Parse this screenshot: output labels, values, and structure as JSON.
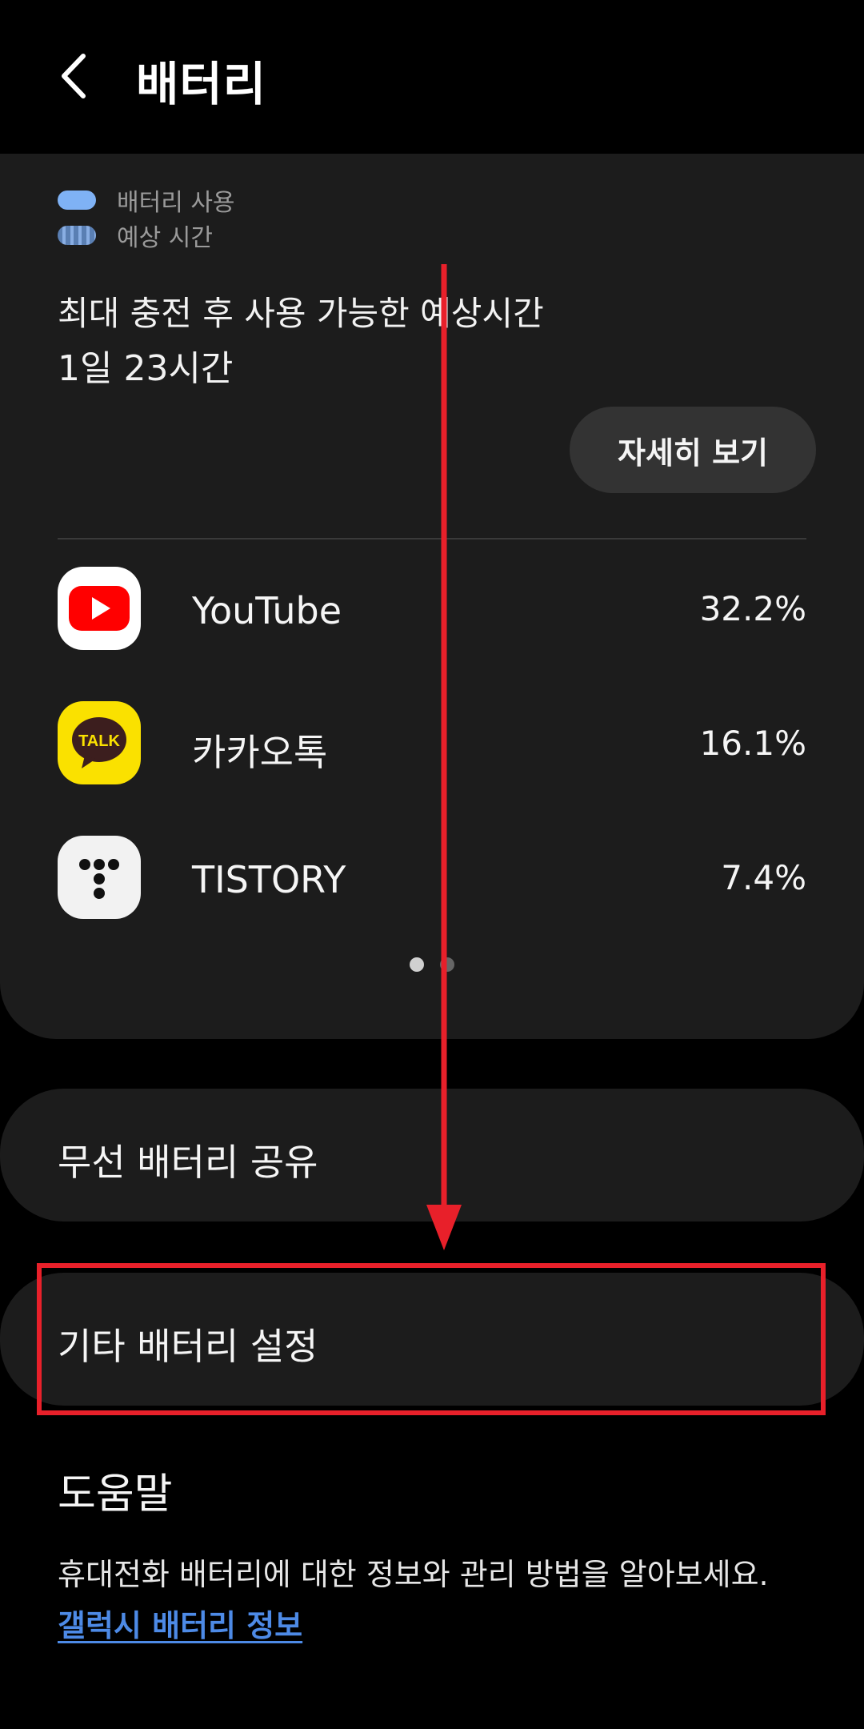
{
  "header": {
    "title": "배터리",
    "back_icon": "chevron-left-icon"
  },
  "legend": [
    {
      "label": "배터리 사용",
      "color": "#7fb2f5"
    },
    {
      "label": "예상 시간",
      "color": "#6a92cc"
    }
  ],
  "estimate": {
    "label": "최대 충전 후 사용 가능한 예상시간",
    "value": "1일 23시간"
  },
  "details_button": "자세히 보기",
  "apps": [
    {
      "name": "YouTube",
      "percent": "32.2%",
      "icon": "youtube-icon"
    },
    {
      "name": "카카오톡",
      "percent": "16.1%",
      "icon": "kakaotalk-icon",
      "icon_text": "TALK"
    },
    {
      "name": "TISTORY",
      "percent": "7.4%",
      "icon": "tistory-icon"
    }
  ],
  "pager": {
    "pages": 2,
    "current": 1
  },
  "settings": {
    "wireless_share": "무선 배터리 공유",
    "other_settings": "기타 배터리 설정"
  },
  "help": {
    "title": "도움말",
    "description": "휴대전화 배터리에 대한 정보와 관리 방법을 알아보세요.",
    "link": "갤럭시 배터리 정보"
  },
  "colors": {
    "background": "#000000",
    "card": "#1c1c1c",
    "link": "#4d8ae6",
    "annotation": "#e8202a"
  }
}
